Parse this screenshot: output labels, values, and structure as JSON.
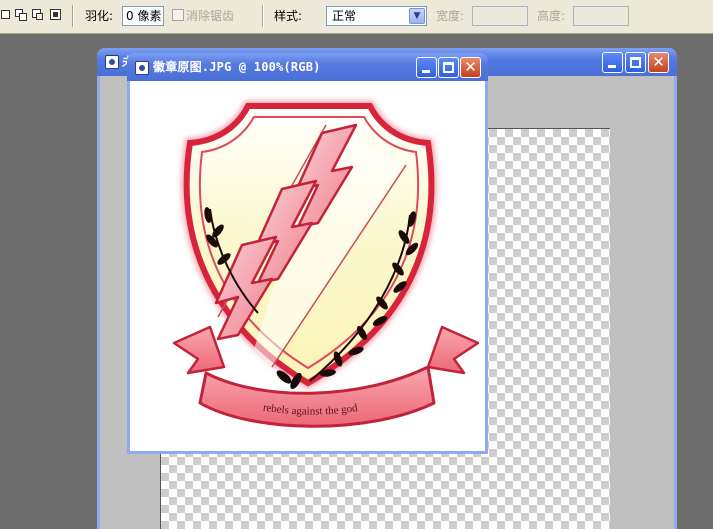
{
  "options_bar": {
    "selection_modes": [
      "new-selection-icon",
      "add-to-selection-icon",
      "subtract-from-selection-icon",
      "intersect-selection-icon"
    ],
    "feather_label": "羽化:",
    "feather_value": "0 像素",
    "anti_alias_label": "消除锯齿",
    "anti_alias_checked": false,
    "style_label": "样式:",
    "style_value": "正常",
    "width_label": "宽度:",
    "width_value": "",
    "height_label": "高度:",
    "height_value": ""
  },
  "back_window": {
    "title": "未",
    "buttons": [
      "minimize-icon",
      "maximize-icon",
      "close-icon"
    ]
  },
  "front_window": {
    "title": "徽章原图.JPG @ 100%(RGB)",
    "buttons": [
      "minimize-icon",
      "maximize-icon",
      "close-icon"
    ],
    "image": {
      "ribbon_text": "rebels against the god",
      "colors": {
        "shield_border": "#d8243a",
        "shield_fill": "#fcf9c8",
        "stripe_fill": "#f08a96",
        "ribbon_fill": "#f47f8a",
        "laurel": "#1a0a0a"
      }
    }
  },
  "colors": {
    "titlebar": "#4a6fd6",
    "toolbar_bg": "#ece9d8",
    "workspace_bg": "#6e6e6e"
  }
}
